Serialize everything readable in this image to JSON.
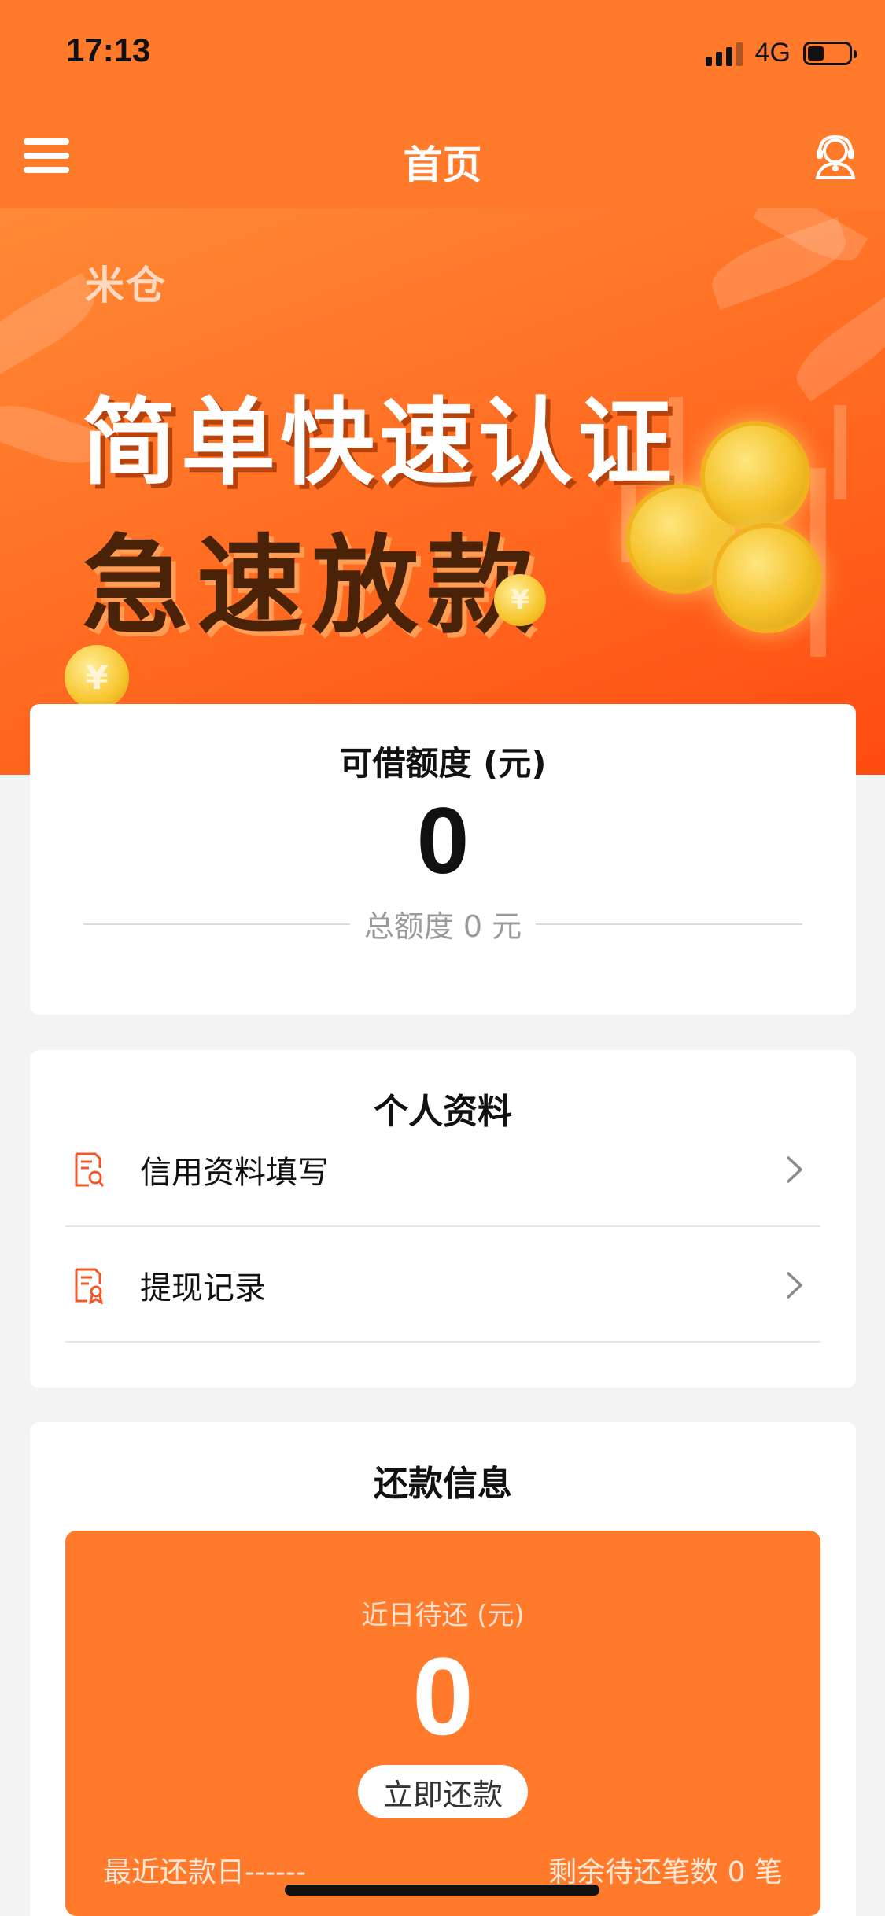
{
  "status_bar": {
    "time": "17:13",
    "network": "4G",
    "battery_level": 0.4
  },
  "nav": {
    "title": "首页",
    "menu_icon": "menu-icon",
    "right_icon": "customer-service-icon"
  },
  "banner": {
    "logo_text": "米仓",
    "line1": "简单快速认证",
    "line2": "急速放款",
    "coin_symbol": "¥"
  },
  "credit": {
    "title": "可借额度 (元)",
    "amount": "0",
    "total": "总额度 0 元"
  },
  "profile": {
    "title": "个人资料",
    "items": [
      {
        "label": "信用资料填写",
        "icon": "document-search-icon"
      },
      {
        "label": "提现记录",
        "icon": "document-record-icon"
      }
    ]
  },
  "repayment": {
    "title": "还款信息",
    "due_label": "近日待还 (元)",
    "due_amount": "0",
    "button_label": "立即还款",
    "last_date": "最近还款日------",
    "remaining": "剩余待还笔数 0 笔"
  },
  "colors": {
    "brand": "#ff7a2a",
    "icon_accent": "#f0582a"
  }
}
